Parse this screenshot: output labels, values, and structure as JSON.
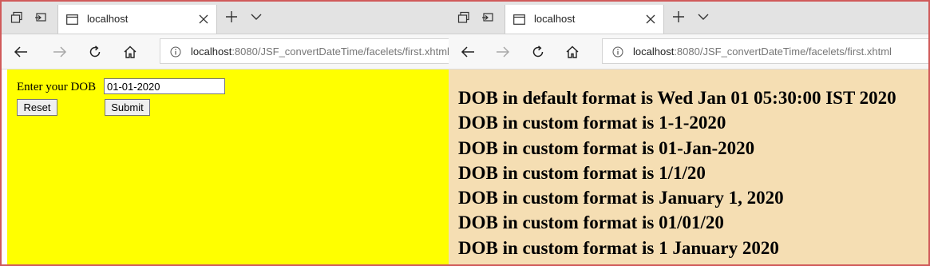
{
  "left_window": {
    "tab": {
      "title": "localhost"
    },
    "address": {
      "host": "localhost",
      "path": ":8080/JSF_convertDateTime/facelets/first.xhtml"
    },
    "form": {
      "label": "Enter your DOB",
      "input_value": "01-01-2020",
      "reset_label": "Reset",
      "submit_label": "Submit"
    }
  },
  "right_window": {
    "tab": {
      "title": "localhost"
    },
    "address": {
      "host": "localhost",
      "path": ":8080/JSF_convertDateTime/facelets/first.xhtml"
    },
    "results": [
      "DOB in default format is Wed Jan 01 05:30:00 IST 2020",
      "DOB in custom format is 1-1-2020",
      "DOB in custom format is 01-Jan-2020",
      "DOB in custom format is 1/1/20",
      "DOB in custom format is January 1, 2020",
      "DOB in custom format is 01/01/20",
      "DOB in custom format is 1 January 2020"
    ]
  },
  "colors": {
    "left_background": "#ffff00",
    "right_background": "#f5deb3",
    "frame_border": "#d05a5a"
  },
  "icons": [
    "tab-actions-icon",
    "tab-aside-icon",
    "page-icon",
    "close-icon",
    "new-tab-icon",
    "chevron-down-icon",
    "back-icon",
    "forward-icon",
    "refresh-icon",
    "home-icon",
    "info-icon"
  ]
}
